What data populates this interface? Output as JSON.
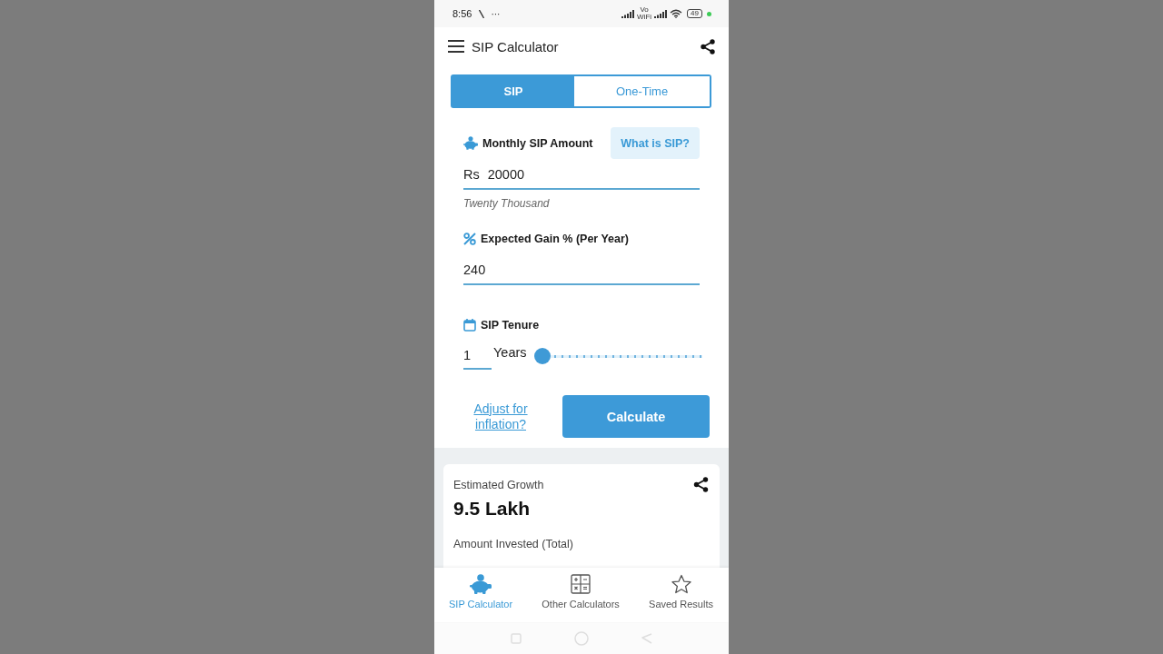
{
  "status_bar": {
    "time": "8:56",
    "overflow": "···",
    "network_top": "Vo",
    "network_bottom": "WiFi",
    "battery": "49"
  },
  "app_bar": {
    "title": "SIP Calculator"
  },
  "tabs": [
    {
      "label": "SIP",
      "selected": true
    },
    {
      "label": "One-Time",
      "selected": false
    }
  ],
  "form": {
    "amount": {
      "label": "Monthly SIP Amount",
      "help_button": "What is SIP?",
      "prefix": "Rs",
      "value": "20000",
      "hint": "Twenty Thousand"
    },
    "gain": {
      "label": "Expected Gain % (Per Year)",
      "value": "240"
    },
    "tenure": {
      "label": "SIP Tenure",
      "value": "1",
      "unit": "Years",
      "level": 0
    },
    "inflation_link": "Adjust for inflation?",
    "calculate_button": "Calculate"
  },
  "results": [
    {
      "label": "Estimated Growth",
      "value": "9.5 Lakh"
    },
    {
      "label": "Amount Invested (Total)"
    }
  ],
  "bottom_nav": [
    {
      "label": "SIP Calculator",
      "selected": true
    },
    {
      "label": "Other Calculators",
      "selected": false
    },
    {
      "label": "Saved Results",
      "selected": false
    }
  ]
}
